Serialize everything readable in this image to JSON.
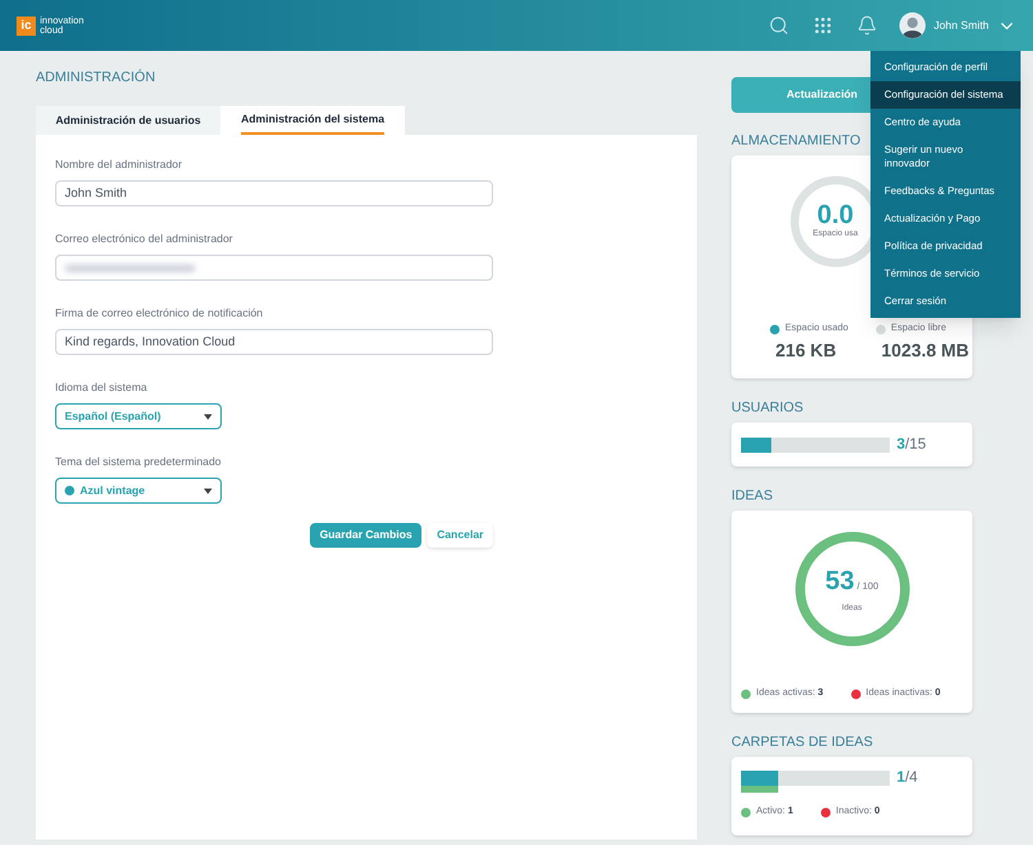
{
  "header": {
    "logo_mark": "ic",
    "logo_text": [
      "innovation",
      "cloud"
    ],
    "user_name": "John Smith"
  },
  "user_menu": {
    "items": [
      {
        "label": "Configuración de perfil",
        "selected": false
      },
      {
        "label": "Configuración del sistema",
        "selected": true
      },
      {
        "label": "Centro de ayuda",
        "selected": false
      },
      {
        "label": "Sugerir un nuevo innovador",
        "selected": false
      },
      {
        "label": "Feedbacks & Preguntas",
        "selected": false
      },
      {
        "label": "Actualización y Pago",
        "selected": false
      },
      {
        "label": "Política de privacidad",
        "selected": false
      },
      {
        "label": "Términos de servicio",
        "selected": false
      },
      {
        "label": "Cerrar sesión",
        "selected": false
      }
    ]
  },
  "page_title": "ADMINISTRACIÓN",
  "tabs": [
    {
      "label": "Administración de usuarios",
      "selected": false
    },
    {
      "label": "Administración del sistema",
      "selected": true
    }
  ],
  "form": {
    "fields": [
      {
        "kind": "text",
        "label": "Nombre del administrador",
        "value": "John Smith"
      },
      {
        "kind": "text",
        "label": "Correo electrónico del administrador",
        "redacted": true
      },
      {
        "kind": "text",
        "label": "Firma de correo electrónico de notificación",
        "value": "Kind regards, Innovation Cloud"
      },
      {
        "kind": "select",
        "label": "Idioma del sistema",
        "value": "Español (Español)"
      },
      {
        "kind": "select",
        "label": "Tema del sistema predeterminado",
        "value": "Azul vintage",
        "color": "#2aa3b0"
      }
    ],
    "buttons": [
      {
        "kind": "primary",
        "label": "Guardar Cambios"
      },
      {
        "kind": "secondary",
        "label": "Cancelar"
      }
    ]
  },
  "upgrade_button": "Actualización",
  "storage": {
    "title": "ALMACENAMIENTO",
    "percent": "0.0",
    "caption": "Espacio usa",
    "legend": [
      {
        "label": "Espacio usado",
        "value": "216 KB",
        "color": "#2aa3b0"
      },
      {
        "label": "Espacio libre",
        "value": "1023.8 MB",
        "color": "#d8dfdf"
      }
    ]
  },
  "users": {
    "title": "USUARIOS",
    "level": 0.2,
    "count": "3",
    "total": "/15"
  },
  "ideas": {
    "title": "IDEAS",
    "count": "53",
    "total": "/ 100",
    "caption": "Ideas",
    "legend": [
      {
        "label": "Ideas activas:",
        "value": "3",
        "color": "#6cc07f"
      },
      {
        "label": "Ideas inactivas:",
        "value": "0",
        "color": "#e8303f"
      }
    ]
  },
  "folders": {
    "title": "CARPETAS DE IDEAS",
    "level": 0.25,
    "active_bar": {
      "level": 0.25
    },
    "count": "1",
    "total": "/4",
    "legend": [
      {
        "label": "Activo:",
        "value": "1",
        "color": "#6cc07f"
      },
      {
        "label": "Inactivo:",
        "value": "0",
        "color": "#e8303f"
      }
    ]
  }
}
